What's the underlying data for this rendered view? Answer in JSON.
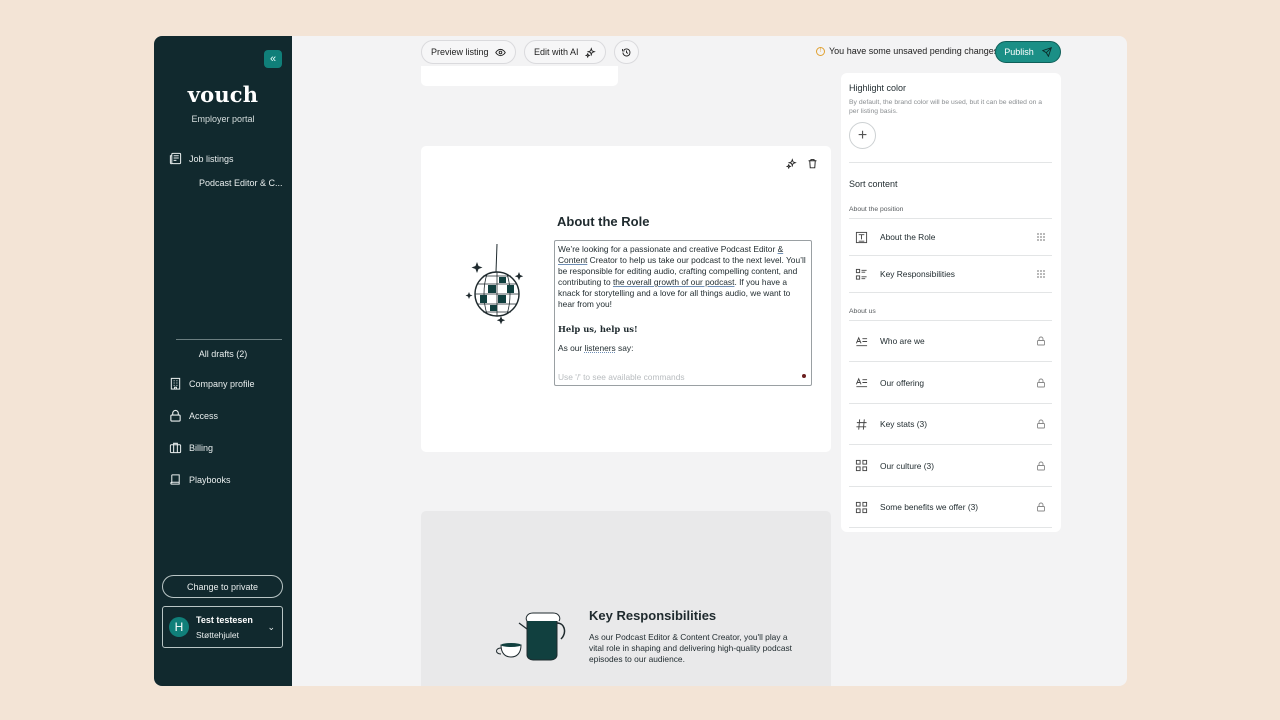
{
  "sidebar": {
    "brand": "vouch",
    "subtitle": "Employer portal",
    "collapse_icon": "«",
    "job_listings": "Job listings",
    "job_item": "Podcast Editor & C...",
    "all_drafts": "All drafts (2)",
    "company_profile": "Company profile",
    "access": "Access",
    "billing": "Billing",
    "playbooks": "Playbooks",
    "change_private": "Change to private",
    "user": {
      "initial": "H",
      "name": "Test testesen",
      "org": "Støttehjulet"
    }
  },
  "toolbar": {
    "preview": "Preview listing",
    "edit_ai": "Edit with AI",
    "pending": "You have some unsaved pending changes",
    "publish": "Publish"
  },
  "role": {
    "title": "About the Role",
    "p1a": "We’re looking for a passionate and creative Podcast Editor ",
    "p1b": "& Content",
    "p1c": " Creator to help us take our podcast to the next level. You’ll be responsible for editing audio, crafting compelling content, and contributing to ",
    "p1d": "the overall growth of our podcast",
    "p1e": ". If you have a knack for storytelling and a love for all things audio, we want to hear from you!",
    "heading": "Help us, help us!",
    "quote_a": "As our ",
    "quote_b": "listeners",
    "quote_c": " say:",
    "placeholder": "Use '/' to see available commands"
  },
  "responsibilities": {
    "title": "Key Responsibilities",
    "text": "As our Podcast Editor & Content Creator, you'll play a vital role in shaping and delivering high-quality podcast episodes to our audience."
  },
  "panel": {
    "highlight_title": "Highlight color",
    "highlight_desc": "By default, the brand color will be used, but it can be edited on a per listing basis.",
    "sort_title": "Sort content",
    "group_position": "About the position",
    "group_us": "About us",
    "rows": [
      {
        "label": "About the Role",
        "icon": "text-block-icon",
        "end": "drag-handle-icon"
      },
      {
        "label": "Key Responsibilities",
        "icon": "list-icon",
        "end": "drag-handle-icon"
      },
      {
        "label": "Who are we",
        "icon": "text-lines-icon",
        "end": "lock-icon"
      },
      {
        "label": "Our offering",
        "icon": "text-lines-icon",
        "end": "lock-icon"
      },
      {
        "label": "Key stats (3)",
        "icon": "hash-icon",
        "end": "lock-icon"
      },
      {
        "label": "Our culture (3)",
        "icon": "grid-icon",
        "end": "lock-icon"
      },
      {
        "label": "Some benefits we offer (3)",
        "icon": "grid-icon",
        "end": "lock-icon"
      }
    ]
  },
  "colors": {
    "sidebar_bg": "#11292e",
    "accent": "#1b8f86",
    "page_bg": "#f3e4d6"
  }
}
